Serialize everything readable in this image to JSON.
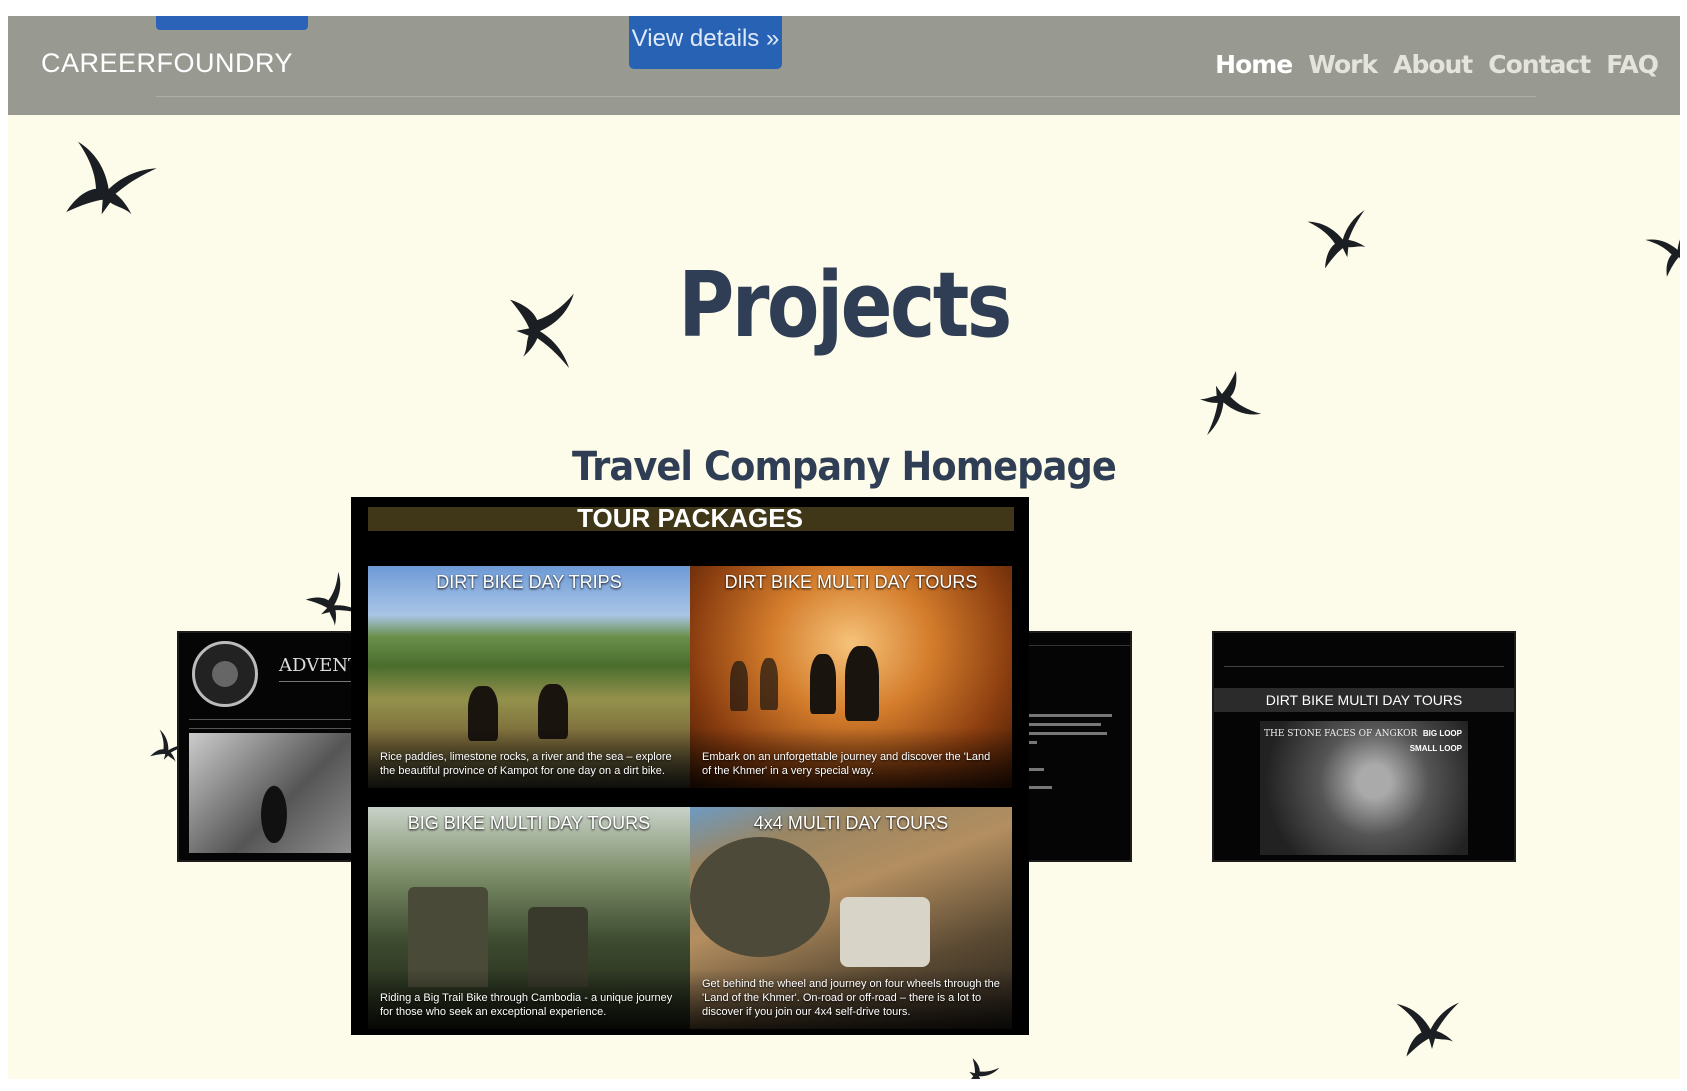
{
  "navbar": {
    "brand": "CAREERFOUNDRY",
    "view_details": "View details »",
    "links": [
      "Home",
      "Work",
      "About",
      "Contact",
      "FAQ"
    ],
    "active": "Home"
  },
  "main": {
    "title": "Projects",
    "project_title": "Travel Company Homepage"
  },
  "carousel": {
    "left_shot": {
      "site_title": "ADVENTUR"
    },
    "right_shot": {
      "heading": "DIRT BIKE MULTI DAY TOURS",
      "caption": "THE STONE FACES OF ANGKOR",
      "loops": [
        "BIG LOOP",
        "SMALL LOOP"
      ]
    },
    "main_shot": {
      "banner": "TOUR PACKAGES",
      "tiles": [
        {
          "title": "DIRT BIKE DAY TRIPS",
          "desc": "Rice paddies, limestone rocks, a river and the sea – explore the beautiful province of Kampot for one day on a dirt bike."
        },
        {
          "title": "DIRT BIKE MULTI DAY TOURS",
          "desc": "Embark on an unforgettable journey and discover the 'Land of the Khmer' in a very special way."
        },
        {
          "title": "BIG BIKE MULTI DAY TOURS",
          "desc": "Riding a Big Trail Bike through Cambodia - a unique journey for those who seek an exceptional experience."
        },
        {
          "title": "4x4 MULTI DAY TOURS",
          "desc": "Get behind the wheel and journey on four wheels through the 'Land of the Khmer'. On-road or off-road – there is a lot to discover if you join our 4x4 self-drive tours."
        }
      ]
    }
  },
  "colors": {
    "navbar": "#989a92",
    "page_bg": "#fdfbea",
    "heading": "#2f3e54",
    "button": "#2762b5"
  },
  "decorations": [
    "bird-silhouette-icon"
  ]
}
